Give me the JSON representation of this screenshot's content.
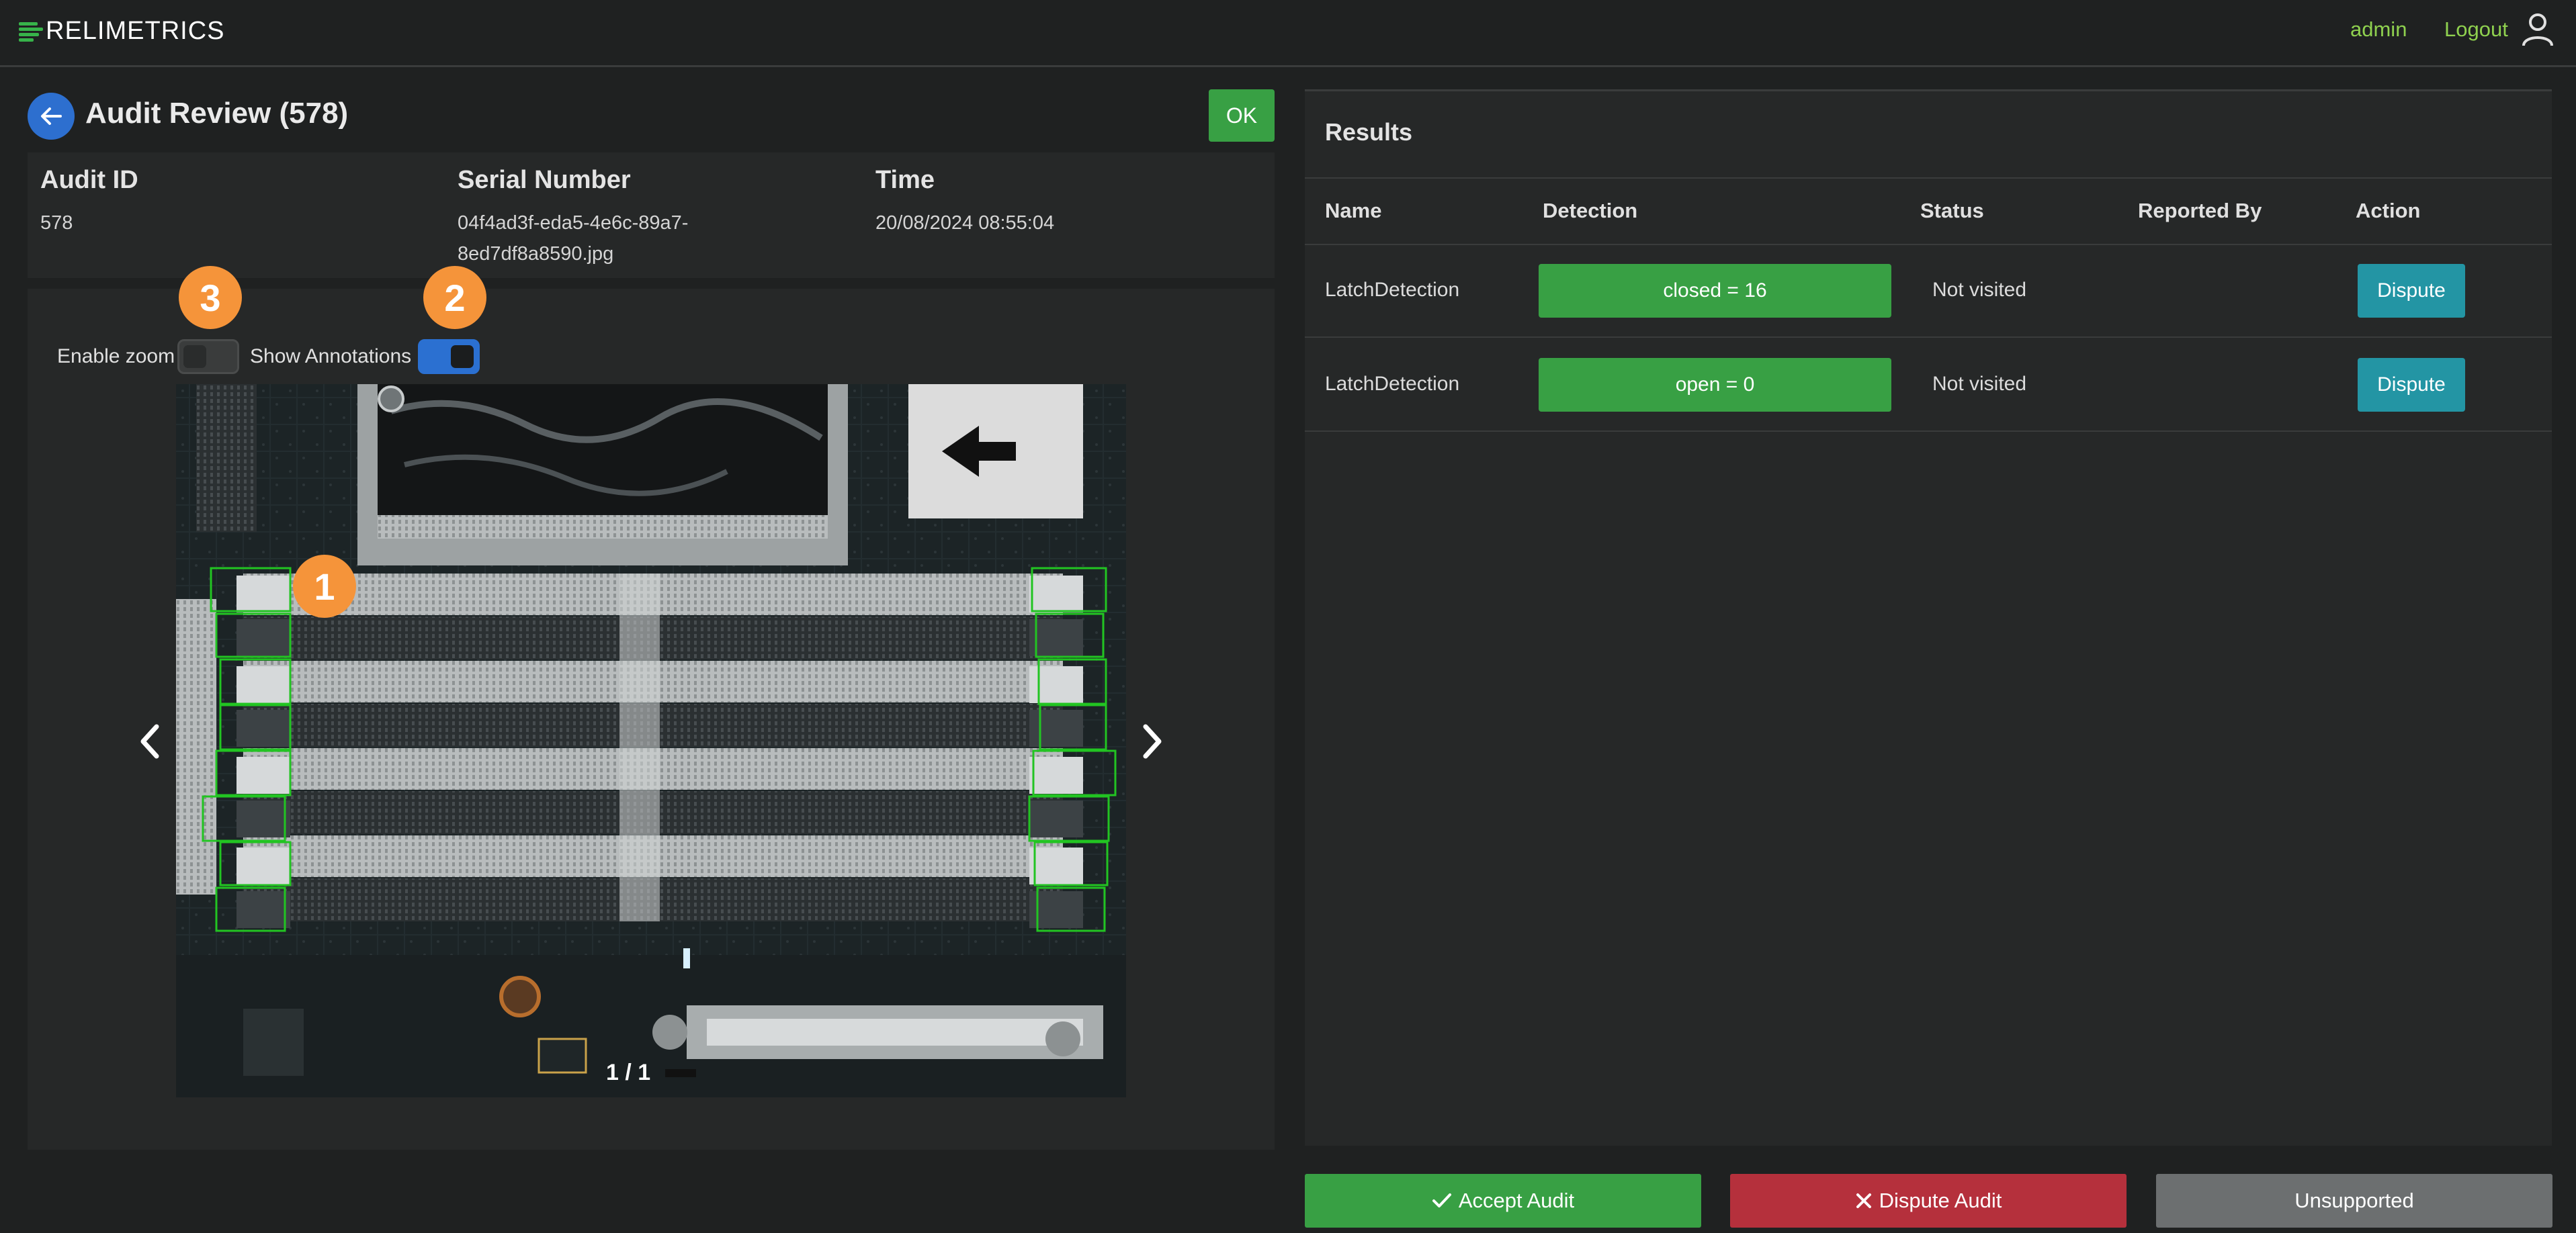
{
  "app": {
    "logo_text": "RELIMETRICS"
  },
  "header": {
    "user": "admin",
    "logout_label": "Logout"
  },
  "review": {
    "title": "Audit Review (578)",
    "ok_label": "OK",
    "fields": [
      {
        "label": "Audit ID",
        "value": "578"
      },
      {
        "label": "Serial Number",
        "value_line1": "04f4ad3f-eda5-4e6c-89a7-",
        "value_line2": "8ed7df8a8590.jpg"
      },
      {
        "label": "Time",
        "value": "20/08/2024 08:55:04"
      }
    ]
  },
  "viewer": {
    "enable_zoom_label": "Enable zoom",
    "enable_zoom_on": false,
    "show_annotations_label": "Show Annotations",
    "show_annotations_on": true,
    "pager": "1 / 1",
    "annotation_color": "#22c422"
  },
  "badges": [
    "1",
    "2",
    "3"
  ],
  "results": {
    "title": "Results",
    "columns": [
      "Name",
      "Detection",
      "Status",
      "Reported By",
      "Action"
    ],
    "rows": [
      {
        "name": "LatchDetection",
        "detection": "closed = 16",
        "status": "Not visited",
        "reported_by": "",
        "action": "Dispute"
      },
      {
        "name": "LatchDetection",
        "detection": "open = 0",
        "status": "Not visited",
        "reported_by": "",
        "action": "Dispute"
      }
    ]
  },
  "footer": {
    "accept_label": "Accept Audit",
    "dispute_label": "Dispute Audit",
    "unsupported_label": "Unsupported"
  },
  "colors": {
    "background": "#1f2121",
    "panel": "#262828",
    "accent_green": "#38a044",
    "accent_blue": "#2b70d1",
    "accent_teal": "#2395a4",
    "danger": "#b5303c",
    "badge_orange": "#f5943a",
    "link_green": "#8fd14f"
  }
}
